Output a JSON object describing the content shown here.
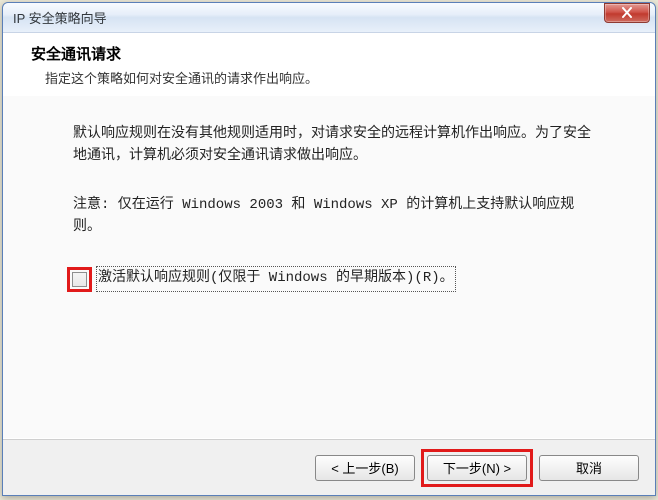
{
  "window": {
    "title": "IP 安全策略向导"
  },
  "banner": {
    "title": "安全通讯请求",
    "subtitle": "指定这个策略如何对安全通讯的请求作出响应。"
  },
  "body": {
    "para1": "默认响应规则在没有其他规则适用时，对请求安全的远程计算机作出响应。为了安全地通讯，计算机必须对安全通讯请求做出响应。",
    "para2": "注意: 仅在运行 Windows 2003 和 Windows XP 的计算机上支持默认响应规则。",
    "checkbox_label": "激活默认响应规则(仅限于 Windows 的早期版本)(R)。"
  },
  "footer": {
    "back": "< 上一步(B)",
    "next": "下一步(N) >",
    "cancel": "取消"
  }
}
